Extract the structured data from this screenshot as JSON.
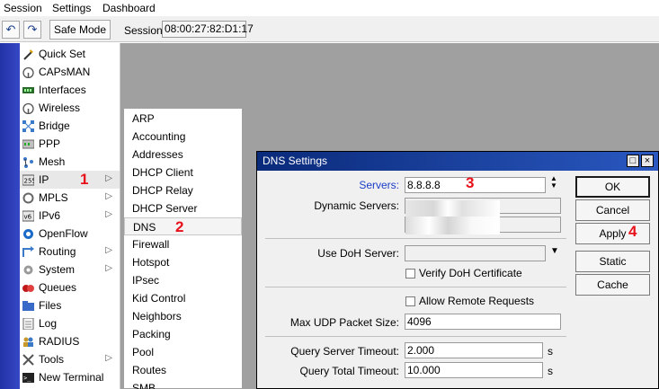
{
  "menubar": {
    "items": [
      "Session",
      "Settings",
      "Dashboard"
    ]
  },
  "toolbar": {
    "undo_icon": "undo-icon",
    "redo_icon": "redo-icon",
    "safe_mode_label": "Safe Mode",
    "session_label": "Session:",
    "session_value": "08:00:27:82:D1:17"
  },
  "sidebar": {
    "items": [
      {
        "label": "Quick Set",
        "icon": "wand-icon",
        "arrow": ""
      },
      {
        "label": "CAPsMAN",
        "icon": "wireless-icon",
        "arrow": ""
      },
      {
        "label": "Interfaces",
        "icon": "interfaces-icon",
        "arrow": ""
      },
      {
        "label": "Wireless",
        "icon": "wireless-icon",
        "arrow": ""
      },
      {
        "label": "Bridge",
        "icon": "bridge-icon",
        "arrow": ""
      },
      {
        "label": "PPP",
        "icon": "ppp-icon",
        "arrow": ""
      },
      {
        "label": "Mesh",
        "icon": "mesh-icon",
        "arrow": ""
      },
      {
        "label": "IP",
        "icon": "ip-icon",
        "arrow": "▷"
      },
      {
        "label": "MPLS",
        "icon": "mpls-icon",
        "arrow": "▷"
      },
      {
        "label": "IPv6",
        "icon": "ipv6-icon",
        "arrow": "▷"
      },
      {
        "label": "OpenFlow",
        "icon": "openflow-icon",
        "arrow": ""
      },
      {
        "label": "Routing",
        "icon": "routing-icon",
        "arrow": "▷"
      },
      {
        "label": "System",
        "icon": "gear-icon",
        "arrow": "▷"
      },
      {
        "label": "Queues",
        "icon": "queues-icon",
        "arrow": ""
      },
      {
        "label": "Files",
        "icon": "folder-icon",
        "arrow": ""
      },
      {
        "label": "Log",
        "icon": "log-icon",
        "arrow": ""
      },
      {
        "label": "RADIUS",
        "icon": "users-icon",
        "arrow": ""
      },
      {
        "label": "Tools",
        "icon": "tools-icon",
        "arrow": "▷"
      },
      {
        "label": "New Terminal",
        "icon": "terminal-icon",
        "arrow": ""
      }
    ]
  },
  "submenu": {
    "items": [
      "ARP",
      "Accounting",
      "Addresses",
      "DHCP Client",
      "DHCP Relay",
      "DHCP Server",
      "DNS",
      "Firewall",
      "Hotspot",
      "IPsec",
      "Kid Control",
      "Neighbors",
      "Packing",
      "Pool",
      "Routes",
      "SMB"
    ]
  },
  "dialog": {
    "title": "DNS Settings",
    "servers_label": "Servers:",
    "servers_value": "8.8.8.8",
    "dynamic_servers_label": "Dynamic Servers:",
    "use_doh_label": "Use DoH Server:",
    "use_doh_value": "",
    "verify_doh_label": "Verify DoH Certificate",
    "allow_remote_label": "Allow Remote Requests",
    "max_udp_label": "Max UDP Packet Size:",
    "max_udp_value": "4096",
    "query_server_timeout_label": "Query Server Timeout:",
    "query_server_timeout_value": "2.000",
    "query_total_timeout_label": "Query Total Timeout:",
    "query_total_timeout_value": "10.000",
    "unit_s": "s",
    "buttons": {
      "ok": "OK",
      "cancel": "Cancel",
      "apply": "Apply",
      "static": "Static",
      "cache": "Cache"
    }
  },
  "annotations": [
    "1",
    "2",
    "3",
    "4"
  ],
  "colors": {
    "accent_red": "#e8101a",
    "title_bar": "#0a2a7a",
    "sidebar_strip": "#2233a8"
  }
}
